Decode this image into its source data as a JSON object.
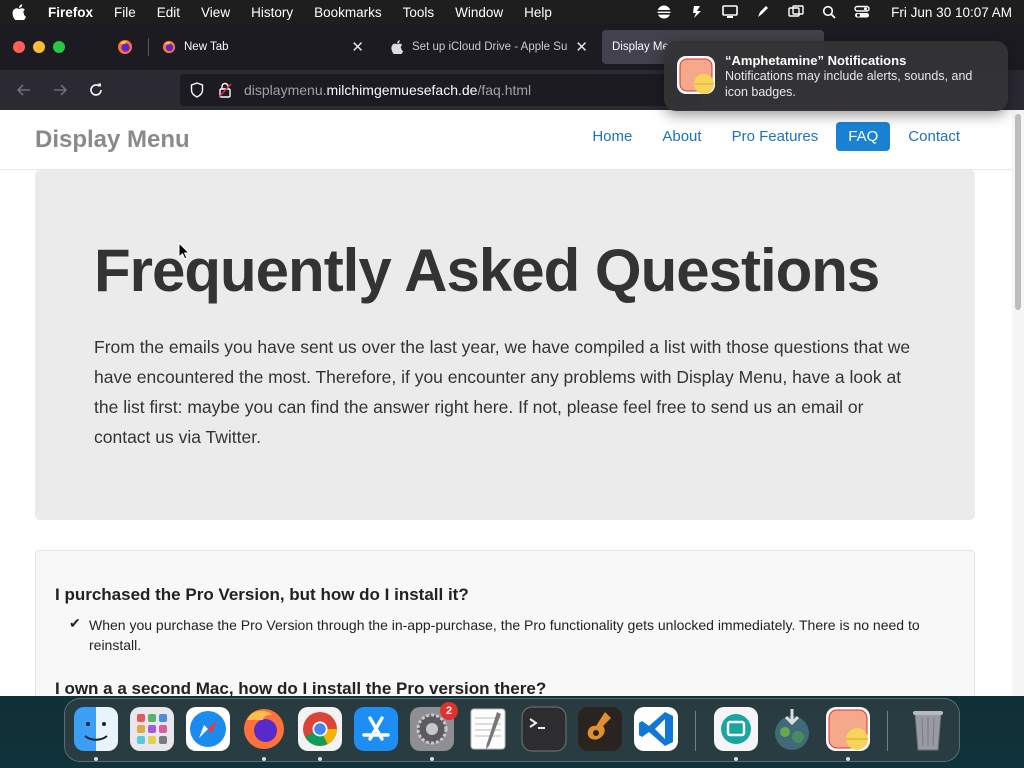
{
  "menubar": {
    "app_name": "Firefox",
    "menus": [
      "File",
      "Edit",
      "View",
      "History",
      "Bookmarks",
      "Tools",
      "Window",
      "Help"
    ],
    "clock": "Fri Jun 30  10:07 AM"
  },
  "tabs": [
    {
      "title": "New Tab"
    },
    {
      "title": "Set up iCloud Drive - Apple Supp"
    },
    {
      "title": "Display Me"
    }
  ],
  "address": {
    "prefix": "displaymenu.",
    "domain": "milchimgemuesefach.de",
    "path": "/faq.html"
  },
  "notification": {
    "title": "“Amphetamine” Notifications",
    "body": "Notifications may include alerts, sounds, and icon badges."
  },
  "site": {
    "brand": "Display Menu",
    "nav": [
      {
        "label": "Home",
        "active": false
      },
      {
        "label": "About",
        "active": false
      },
      {
        "label": "Pro Features",
        "active": false
      },
      {
        "label": "FAQ",
        "active": true
      },
      {
        "label": "Contact",
        "active": false
      }
    ],
    "heading": "Frequently Asked Questions",
    "intro": "From the emails you have sent us over the last year, we have compiled a list with those questions that we have encountered the most. Therefore, if you encounter any problems with Display Menu, have a look at the list first: maybe you can find the answer right here. If not, please feel free to send us an email or contact us via Twitter.",
    "faq": [
      {
        "question": "I purchased the Pro Version, but how do I install it?",
        "answer": "When you purchase the Pro Version through the in-app-purchase, the Pro functionality gets unlocked immediately. There is no need to reinstall."
      },
      {
        "question": "I own a a second Mac, how do I install the Pro version there?",
        "answer": ""
      }
    ]
  },
  "dock": {
    "items": [
      "finder-icon",
      "launchpad-icon",
      "safari-icon",
      "firefox-icon",
      "chrome-icon",
      "app-store-icon",
      "system-settings-icon",
      "textedit-icon",
      "terminal-icon",
      "garageband-icon",
      "vscode-icon",
      "screen-sharing-icon",
      "downloads-icon",
      "amphetamine-icon",
      "trash-icon"
    ],
    "settings_badge": "2"
  }
}
